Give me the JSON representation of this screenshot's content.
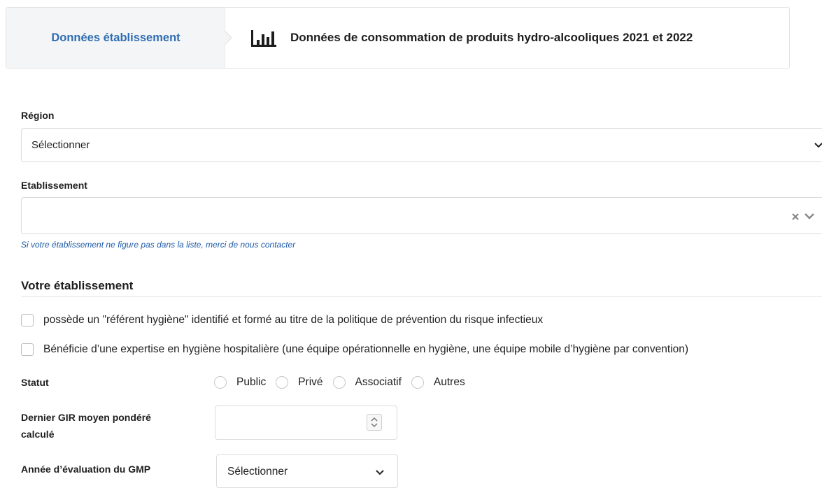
{
  "stepper": {
    "step1_label": "Données établissement",
    "step2_label": "Données de consommation de produits hydro-alcooliques 2021 et 2022"
  },
  "region": {
    "label": "Région",
    "value": "Sélectionner"
  },
  "etablissement": {
    "label": "Etablissement",
    "value": "",
    "help": "Si votre établissement ne figure pas dans la liste, merci de nous contacter"
  },
  "section": {
    "title": "Votre établissement",
    "checkbox1": "possède un \"référent hygiène\" identifié et formé au titre de la politique de prévention du risque infectieux",
    "checkbox2": "Bénéficie d’une expertise en hygiène hospitalière (une équipe opérationnelle en hygiène, une équipe mobile d’hygiène par convention)"
  },
  "statut": {
    "label": "Statut",
    "options": [
      "Public",
      "Privé",
      "Associatif",
      "Autres"
    ]
  },
  "gir": {
    "label_line1": "Dernier GIR moyen pondéré",
    "label_line2": "calculé",
    "value": ""
  },
  "gmp": {
    "label": "Année d’évaluation du GMP",
    "value": "Sélectionner"
  },
  "colors": {
    "accent": "#2f6db3",
    "help": "#1e5aa8"
  }
}
